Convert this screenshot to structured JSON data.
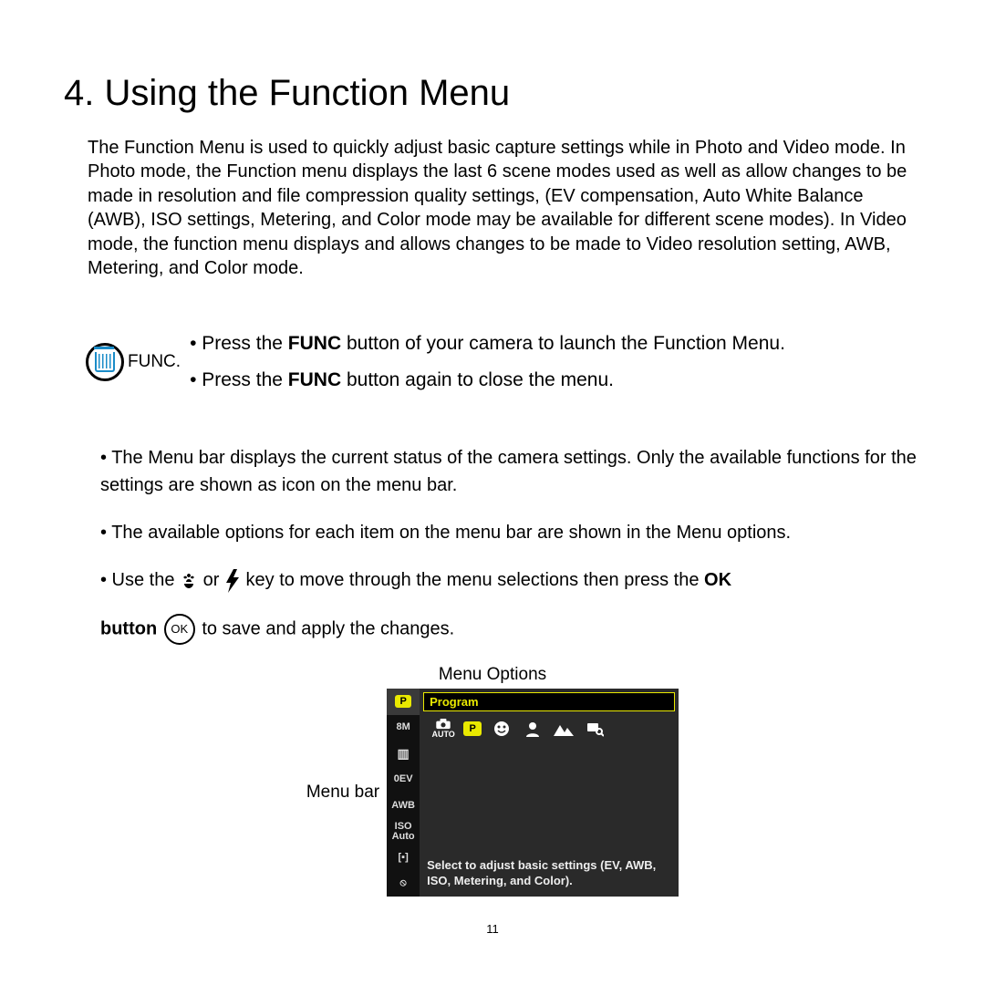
{
  "heading": "4. Using the Function Menu",
  "intro": "The Function Menu is used to quickly adjust basic capture settings while in Photo and Video mode. In Photo mode, the Function menu displays the last 6 scene modes used as well as allow changes to be made in resolution and file compression quality settings, (EV compensation, Auto White Balance (AWB), ISO settings, Metering, and Color mode may be available for different scene modes). In Video mode, the function menu displays and allows changes to be made to Video resolution setting, AWB, Metering, and Color mode.",
  "func_label": "FUNC.",
  "func_bullet1_pre": "• Press the ",
  "func_bullet1_bold": "FUNC",
  "func_bullet1_post": " button of your camera to launch the Function Menu.",
  "func_bullet2_pre": "• Press the ",
  "func_bullet2_bold": "FUNC",
  "func_bullet2_post": " button again to close the menu.",
  "body1": "•  The Menu bar displays the current status of the camera settings.  Only the available functions for the settings are shown as icon on the menu bar.",
  "body2": "•  The available options for each item on the menu bar are shown in the Menu options.",
  "body3_pre": "•  Use the ",
  "body3_or": " or ",
  "body3_mid": " key to move through the menu selections then press the ",
  "body3_ok_bold": "OK",
  "body4_button_bold": "button",
  "ok_label": "OK",
  "body4_post": " to save and apply the changes.",
  "menu_options_label": "Menu Options",
  "menu_bar_label": "Menu bar",
  "lcd": {
    "program": "Program",
    "side": {
      "p": "P",
      "size": "8M",
      "qual": "▯",
      "ev": "0EV",
      "awb": "AWB",
      "iso": "ISO\nAuto",
      "meter": "[▪]",
      "color": "⦸"
    },
    "mode_p": "P",
    "mode_auto_sub": "AUTO",
    "help": "Select to adjust basic settings (EV, AWB, ISO, Metering, and Color)."
  },
  "page_number": "11"
}
